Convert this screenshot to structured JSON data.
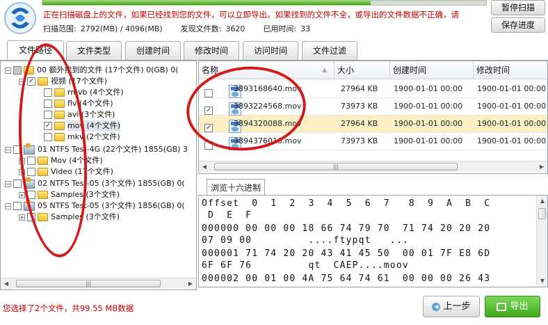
{
  "progress_fraction": 0.74,
  "status": {
    "message": "正在扫描磁盘上的文件，如果已经找到您的文件，可以立即导出。如果找到的文件不全，或导出的文件数据不正确，请",
    "scan_range_label": "扫描范围:",
    "scan_range_value": "2792(MB) / 4096(MB)",
    "found_label": "发现文件数:",
    "found_value": "3620",
    "elapsed_label": "已用时间:",
    "elapsed_value": "33"
  },
  "buttons": {
    "pause": "暂停扫描",
    "save": "保存进度",
    "prev": "上一步",
    "export": "导出"
  },
  "tabs": [
    "文件路径",
    "文件类型",
    "创建时间",
    "修改时间",
    "访问时间",
    "文件过滤"
  ],
  "tree": [
    {
      "text": "00  额外找到的文件    (17个文件)  0(GB) 0("
    },
    {
      "text": "视频    (17个文件)"
    },
    {
      "text": "rmvb    (4个文件)"
    },
    {
      "text": "flv    (4个文件)"
    },
    {
      "text": "avi    (3个文件)"
    },
    {
      "text": "mov    (4个文件)"
    },
    {
      "text": "mkv    (2个文件)"
    },
    {
      "text": "01  NTFS Test-4G    (22个文件)  1855(GB) 3"
    },
    {
      "text": "Mov    (4个文件)"
    },
    {
      "text": "Video    (17个文件)"
    },
    {
      "text": "02  NTFS Test-05    (3个文件)  1855(GB) 0("
    },
    {
      "text": "Samples    (3个文件)"
    },
    {
      "text": "05  NTFS Test-05    (3个文件)  1856(GB) 0("
    },
    {
      "text": "Samples    (3个文件)"
    }
  ],
  "file_table": {
    "headers": [
      "名称",
      "大小",
      "创建时间",
      "修改时间"
    ],
    "rows": [
      {
        "name": "3893168640.mov",
        "size": "27964 KB",
        "created": "1900-01-01  00:00",
        "modified": "1900-01-01  00:00"
      },
      {
        "name": "3893224568.mov",
        "size": "73973 KB",
        "created": "1900-01-01  00:00",
        "modified": "1900-01-01  00:00"
      },
      {
        "name": "3894320088.mov",
        "size": "27964 KB",
        "created": "1900-01-01  00:00",
        "modified": "1900-01-01  00:00"
      },
      {
        "name": "3894376016.mov",
        "size": "73973 KB",
        "created": "1900-01-01  00:00",
        "modified": "1900-01-01  00:00"
      }
    ]
  },
  "hex": {
    "tab_label": "浏览十六进制",
    "lines": [
      "Offset  0  1  2  3  4  5  6  7   8  9  A  B  C",
      " D  E  F",
      "000000 00 00 00 18 66 74 79 70  71 74 20 20 20",
      "07 09 00         ....ftypqt   ...",
      "000001 71 74 20 20 43 41 45 50  00 01 7F E8 6D",
      "6F 6F 76         qt  CAEP....moov",
      "000002 00 01 00 4A 75 64 74 61  00 00 00 26 43"
    ]
  },
  "footer": {
    "selection_message": "您选择了2个文件，共99.55 MB数据"
  },
  "colors": {
    "accent_green": "#3fa51c",
    "alert_red": "#c00000",
    "annotation_red": "#d21a1a",
    "selection": "#fdefc4"
  }
}
